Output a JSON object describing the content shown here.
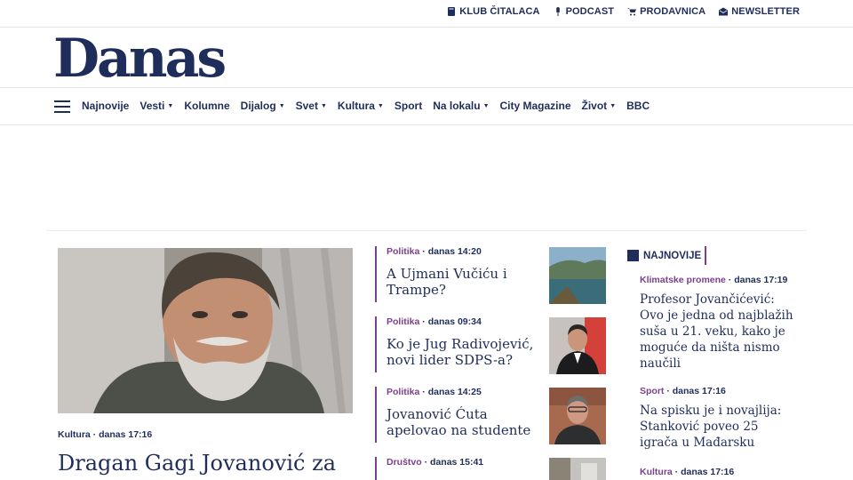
{
  "topbar": {
    "links": [
      {
        "label": "KLUB ČITALACA",
        "icon": "book-icon"
      },
      {
        "label": "PODCAST",
        "icon": "microphone-icon"
      },
      {
        "label": "PRODAVNICA",
        "icon": "cart-icon"
      },
      {
        "label": "NEWSLETTER",
        "icon": "envelope-icon"
      }
    ]
  },
  "logo": "Danas",
  "nav": {
    "items": [
      {
        "label": "Najnovije",
        "dropdown": false
      },
      {
        "label": "Vesti",
        "dropdown": true
      },
      {
        "label": "Kolumne",
        "dropdown": false
      },
      {
        "label": "Dijalog",
        "dropdown": true
      },
      {
        "label": "Svet",
        "dropdown": true
      },
      {
        "label": "Kultura",
        "dropdown": true
      },
      {
        "label": "Sport",
        "dropdown": false
      },
      {
        "label": "Na lokalu",
        "dropdown": true
      },
      {
        "label": "City Magazine",
        "dropdown": false
      },
      {
        "label": "Život",
        "dropdown": true
      },
      {
        "label": "BBC",
        "dropdown": false
      }
    ],
    "caret": "▼"
  },
  "lead": {
    "category": "Kultura",
    "time": "danas 17:16",
    "title": "Dragan Gagi Jovanović za"
  },
  "middle": [
    {
      "category": "Politika",
      "time": "danas 14:20",
      "title": "A Ujmani Vučiću i Trampe?"
    },
    {
      "category": "Politika",
      "time": "danas 09:34",
      "title": "Ko je Jug Radivojević, novi lider SDPS-a?"
    },
    {
      "category": "Politika",
      "time": "danas 14:25",
      "title": "Jovanović Ćuta apelovao na studente"
    },
    {
      "category": "Društvo",
      "time": "danas 15:41",
      "title": ""
    }
  ],
  "latest": {
    "heading": "NAJNOVIJE",
    "items": [
      {
        "category": "Klimatske promene",
        "time": "danas 17:19",
        "title": "Profesor Jovančićević: Ovo je jedna od najblažih suša u 21. veku, kako je moguće da ništa nismo naučili"
      },
      {
        "category": "Sport",
        "time": "danas 17:16",
        "title": "Na spisku je i novajlija: Stanković poveo 25 igrača u Mađarsku"
      },
      {
        "category": "Kultura",
        "time": "danas 17:16",
        "title": ""
      }
    ]
  },
  "colors": {
    "navy": "#1f2d5a",
    "accent": "#7b3f8c"
  }
}
